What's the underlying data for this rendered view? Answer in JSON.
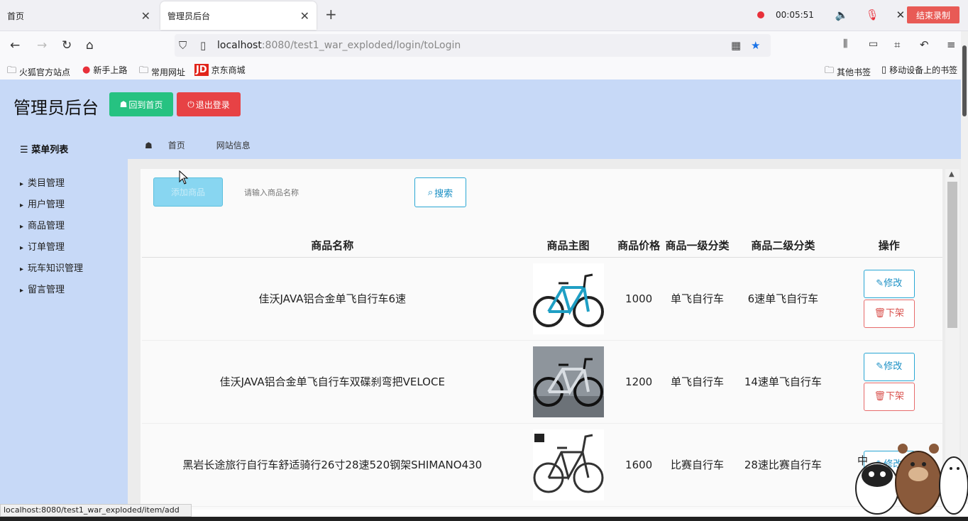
{
  "browser": {
    "tabs": [
      {
        "label": "首页"
      },
      {
        "label": "管理员后台"
      }
    ],
    "recorder": {
      "time": "00:05:51",
      "stop_label": "结束录制"
    },
    "url": {
      "host": "localhost",
      "rest": ":8080/test1_war_exploded/login/toLogin"
    },
    "bookmarks": [
      "火狐官方站点",
      "新手上路",
      "常用网址",
      "京东商城"
    ],
    "bookmarks_right": [
      "其他书签",
      "移动设备上的书签"
    ],
    "jd_badge": "JD",
    "status_url": "localhost:8080/test1_war_exploded/item/add"
  },
  "header": {
    "title": "管理员后台",
    "home_btn": "回到首页",
    "logout_btn": "退出登录"
  },
  "breadcrumb": [
    "首页",
    "网站信息"
  ],
  "sidebar": {
    "title": "菜单列表",
    "items": [
      "类目管理",
      "用户管理",
      "商品管理",
      "订单管理",
      "玩车知识管理",
      "留言管理"
    ]
  },
  "toolbar": {
    "add_label": "添加商品",
    "search_placeholder": "请输入商品名称",
    "search_label": "搜索"
  },
  "table": {
    "columns": [
      "商品名称",
      "商品主图",
      "商品价格",
      "商品一级分类",
      "商品二级分类",
      "操作"
    ],
    "rows": [
      {
        "name": "佳沃JAVA铝合金单飞自行车6速",
        "price": "1000",
        "cat1": "单飞自行车",
        "cat2": "6速单飞自行车"
      },
      {
        "name": "佳沃JAVA铝合金单飞自行车双碟刹弯把VELOCE",
        "price": "1200",
        "cat1": "单飞自行车",
        "cat2": "14速单飞自行车"
      },
      {
        "name": "黑岩长途旅行自行车舒适骑行26寸28速520钢架SHIMANO430",
        "price": "1600",
        "cat1": "比赛自行车",
        "cat2": "28速比赛自行车"
      }
    ],
    "edit_label": "修改",
    "offline_label": "下架"
  },
  "ime_label": "中",
  "colors": {
    "header_bg": "#c7d9f7",
    "btn_home": "#26c281",
    "btn_logout": "#e74245",
    "edit_border": "#2aa7d4",
    "offline_border": "#e76b6b"
  }
}
